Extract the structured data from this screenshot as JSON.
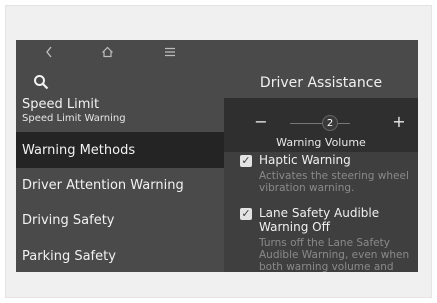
{
  "nav": {
    "back_icon": "back-arrow-icon",
    "home_icon": "home-icon",
    "menu_icon": "menu-icon"
  },
  "left_menu": {
    "items": [
      {
        "title": "Speed Limit",
        "subtitle": "Speed Limit Warning"
      },
      {
        "title": "Warning Methods"
      },
      {
        "title": "Driver Attention Warning"
      },
      {
        "title": "Driving Safety"
      },
      {
        "title": "Parking Safety"
      }
    ],
    "selected": "Warning Methods"
  },
  "panel": {
    "title": "Driver Assistance",
    "volume": {
      "value": "2",
      "label": "Warning Volume",
      "minus": "−",
      "plus": "+"
    },
    "options": [
      {
        "title": "Haptic Warning",
        "description": "Activates the steering wheel vibration warning.",
        "checked": true
      },
      {
        "title": "Lane Safety Audible Warning Off",
        "description": "Turns off the Lane Safety Audible Warning, even when both warning volume and",
        "checked": true
      }
    ]
  },
  "colors": {
    "screen_bg": "#4a4a4a",
    "selected_bg": "#242424",
    "panel_bg": "#3f3f3f"
  }
}
